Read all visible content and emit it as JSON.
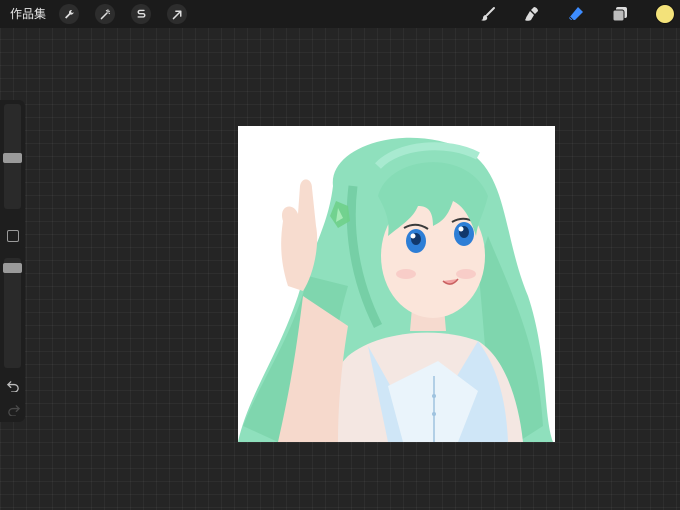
{
  "topbar": {
    "gallery_label": "作品集",
    "left_tools": [
      {
        "icon": "wrench-icon"
      },
      {
        "icon": "magic-wand-icon"
      },
      {
        "icon": "selection-icon"
      },
      {
        "icon": "transform-arrow-icon"
      }
    ],
    "right_tools": [
      {
        "icon": "brush-icon"
      },
      {
        "icon": "smudge-icon"
      },
      {
        "icon": "eraser-icon"
      },
      {
        "icon": "layers-icon"
      }
    ],
    "current_color": "#f3e27a",
    "active_tool_color": "#3d8cff"
  },
  "sidebar": {
    "brush_size_level": 0.5,
    "opacity_level": 0.05,
    "icons": [
      "square-modify-icon",
      "undo-icon",
      "redo-icon"
    ]
  },
  "canvas": {
    "content": "anime-girl-artwork-icon",
    "hair_color": "#7fd9b0",
    "background": "#ffffff"
  }
}
